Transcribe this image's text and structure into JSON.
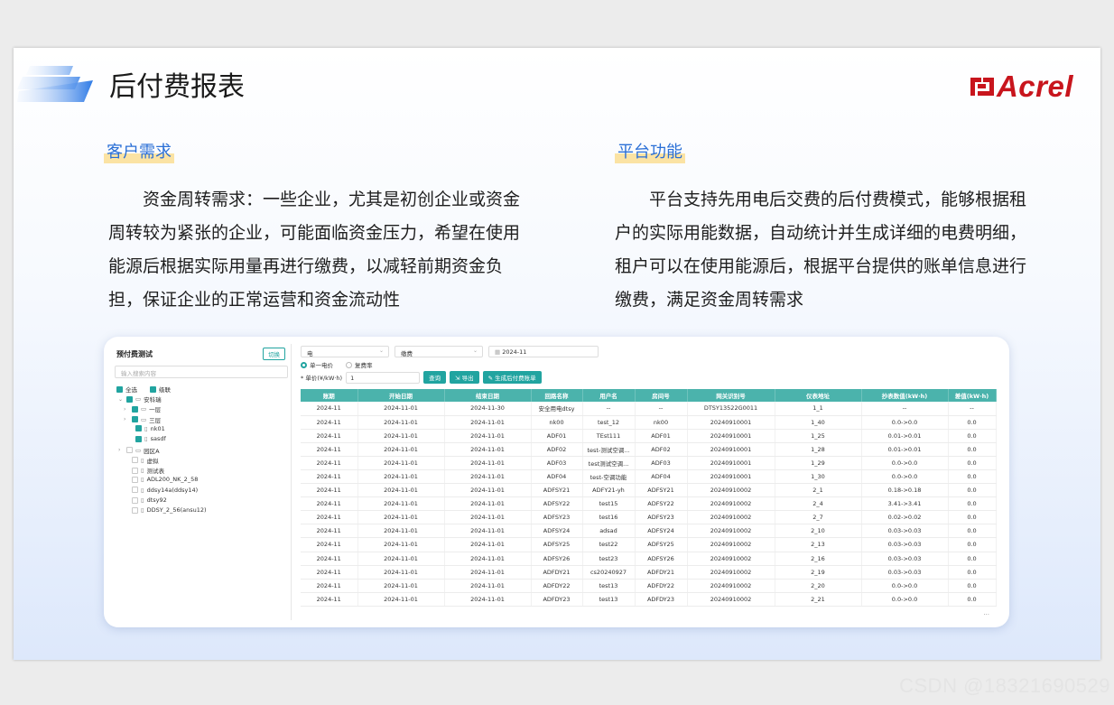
{
  "slide": {
    "title": "后付费报表",
    "logo_text": "Acrel",
    "logo_color": "#c8151d",
    "accent_color": "#2a6fd6",
    "highlight_color": "#fbe3a4"
  },
  "left_section": {
    "heading": "客户需求",
    "text": "资金周转需求：一些企业，尤其是初创企业或资金周转较为紧张的企业，可能面临资金压力，希望在使用能源后根据实际用量再进行缴费，以减轻前期资金负担，保证企业的正常运营和资金流动性"
  },
  "right_section": {
    "heading": "平台功能",
    "text": "平台支持先用电后交费的后付费模式，能够根据租户的实际用能数据，自动统计并生成详细的电费明细，租户可以在使用能源后，根据平台提供的账单信息进行缴费，满足资金周转需求"
  },
  "app": {
    "theme_color": "#21a4a0",
    "tree": {
      "title": "预付费测试",
      "switch_label": "切换",
      "search_placeholder": "输入搜索内容",
      "select_all": "全选",
      "linkage": "级联",
      "nodes": [
        {
          "label": "安科瑞",
          "checked": true,
          "caret": "⌄",
          "folder": true
        },
        {
          "label": "一层",
          "checked": true,
          "caret": "›",
          "folder": true
        },
        {
          "label": "三层",
          "checked": true,
          "caret": "›",
          "folder": true
        },
        {
          "label": "nk01",
          "checked": true,
          "caret": "",
          "folder": false
        },
        {
          "label": "sasdf",
          "checked": true,
          "caret": "",
          "folder": false
        },
        {
          "label": "园区A",
          "checked": false,
          "caret": "›",
          "folder": true
        },
        {
          "label": "虚拟",
          "checked": false,
          "caret": "",
          "folder": false
        },
        {
          "label": "测试表",
          "checked": false,
          "caret": "",
          "folder": false
        },
        {
          "label": "ADL200_NK_2_58",
          "checked": false,
          "caret": "",
          "folder": false
        },
        {
          "label": "ddsy14a(ddsy14)",
          "checked": false,
          "caret": "",
          "folder": false
        },
        {
          "label": "dtsy92",
          "checked": false,
          "caret": "",
          "folder": false
        },
        {
          "label": "DDSY_2_56(ansu12)",
          "checked": false,
          "caret": "",
          "folder": false
        }
      ]
    },
    "filters": {
      "energy_type": "电",
      "fee_type": "缴费",
      "month": "2024-11",
      "radio_single": "单一电价",
      "radio_multi": "复费率",
      "price_label": "* 单价(¥/kW·h)",
      "price_value": "1",
      "btn_query": "查询",
      "btn_export": "导出",
      "btn_generate": "生成后付费账单"
    },
    "table": {
      "columns": [
        "账期",
        "开始日期",
        "结束日期",
        "回路名称",
        "用户名",
        "房间号",
        "网关识别号",
        "仪表地址",
        "抄表数值(kW·h)",
        "差值(kW·h)"
      ],
      "rows": [
        [
          "2024-11",
          "2024-11-01",
          "2024-11-30",
          "安全用电dtsy",
          "--",
          "--",
          "DTSY13522G0011",
          "1_1",
          "--",
          "--"
        ],
        [
          "2024-11",
          "2024-11-01",
          "2024-11-01",
          "nk00",
          "test_12",
          "nk00",
          "20240910001",
          "1_40",
          "0.0->0.0",
          "0.0"
        ],
        [
          "2024-11",
          "2024-11-01",
          "2024-11-01",
          "ADF01",
          "TEst111",
          "ADF01",
          "20240910001",
          "1_25",
          "0.01->0.01",
          "0.0"
        ],
        [
          "2024-11",
          "2024-11-01",
          "2024-11-01",
          "ADF02",
          "test-测试空调...",
          "ADF02",
          "20240910001",
          "1_28",
          "0.01->0.01",
          "0.0"
        ],
        [
          "2024-11",
          "2024-11-01",
          "2024-11-01",
          "ADF03",
          "test测试空调...",
          "ADF03",
          "20240910001",
          "1_29",
          "0.0->0.0",
          "0.0"
        ],
        [
          "2024-11",
          "2024-11-01",
          "2024-11-01",
          "ADF04",
          "test-空调功能",
          "ADF04",
          "20240910001",
          "1_30",
          "0.0->0.0",
          "0.0"
        ],
        [
          "2024-11",
          "2024-11-01",
          "2024-11-01",
          "ADFSY21",
          "ADFY21-yh",
          "ADFSY21",
          "20240910002",
          "2_1",
          "0.18->0.18",
          "0.0"
        ],
        [
          "2024-11",
          "2024-11-01",
          "2024-11-01",
          "ADFSY22",
          "test15",
          "ADFSY22",
          "20240910002",
          "2_4",
          "3.41->3.41",
          "0.0"
        ],
        [
          "2024-11",
          "2024-11-01",
          "2024-11-01",
          "ADFSY23",
          "test16",
          "ADFSY23",
          "20240910002",
          "2_7",
          "0.02->0.02",
          "0.0"
        ],
        [
          "2024-11",
          "2024-11-01",
          "2024-11-01",
          "ADFSY24",
          "adsad",
          "ADFSY24",
          "20240910002",
          "2_10",
          "0.03->0.03",
          "0.0"
        ],
        [
          "2024-11",
          "2024-11-01",
          "2024-11-01",
          "ADFSY25",
          "test22",
          "ADFSY25",
          "20240910002",
          "2_13",
          "0.03->0.03",
          "0.0"
        ],
        [
          "2024-11",
          "2024-11-01",
          "2024-11-01",
          "ADFSY26",
          "test23",
          "ADFSY26",
          "20240910002",
          "2_16",
          "0.03->0.03",
          "0.0"
        ],
        [
          "2024-11",
          "2024-11-01",
          "2024-11-01",
          "ADFDY21",
          "cs20240927",
          "ADFDY21",
          "20240910002",
          "2_19",
          "0.03->0.03",
          "0.0"
        ],
        [
          "2024-11",
          "2024-11-01",
          "2024-11-01",
          "ADFDY22",
          "test13",
          "ADFDY22",
          "20240910002",
          "2_20",
          "0.0->0.0",
          "0.0"
        ],
        [
          "2024-11",
          "2024-11-01",
          "2024-11-01",
          "ADFDY23",
          "test13",
          "ADFDY23",
          "20240910002",
          "2_21",
          "0.0->0.0",
          "0.0"
        ]
      ],
      "pager": "..."
    }
  },
  "watermark": "CSDN @18321690529"
}
